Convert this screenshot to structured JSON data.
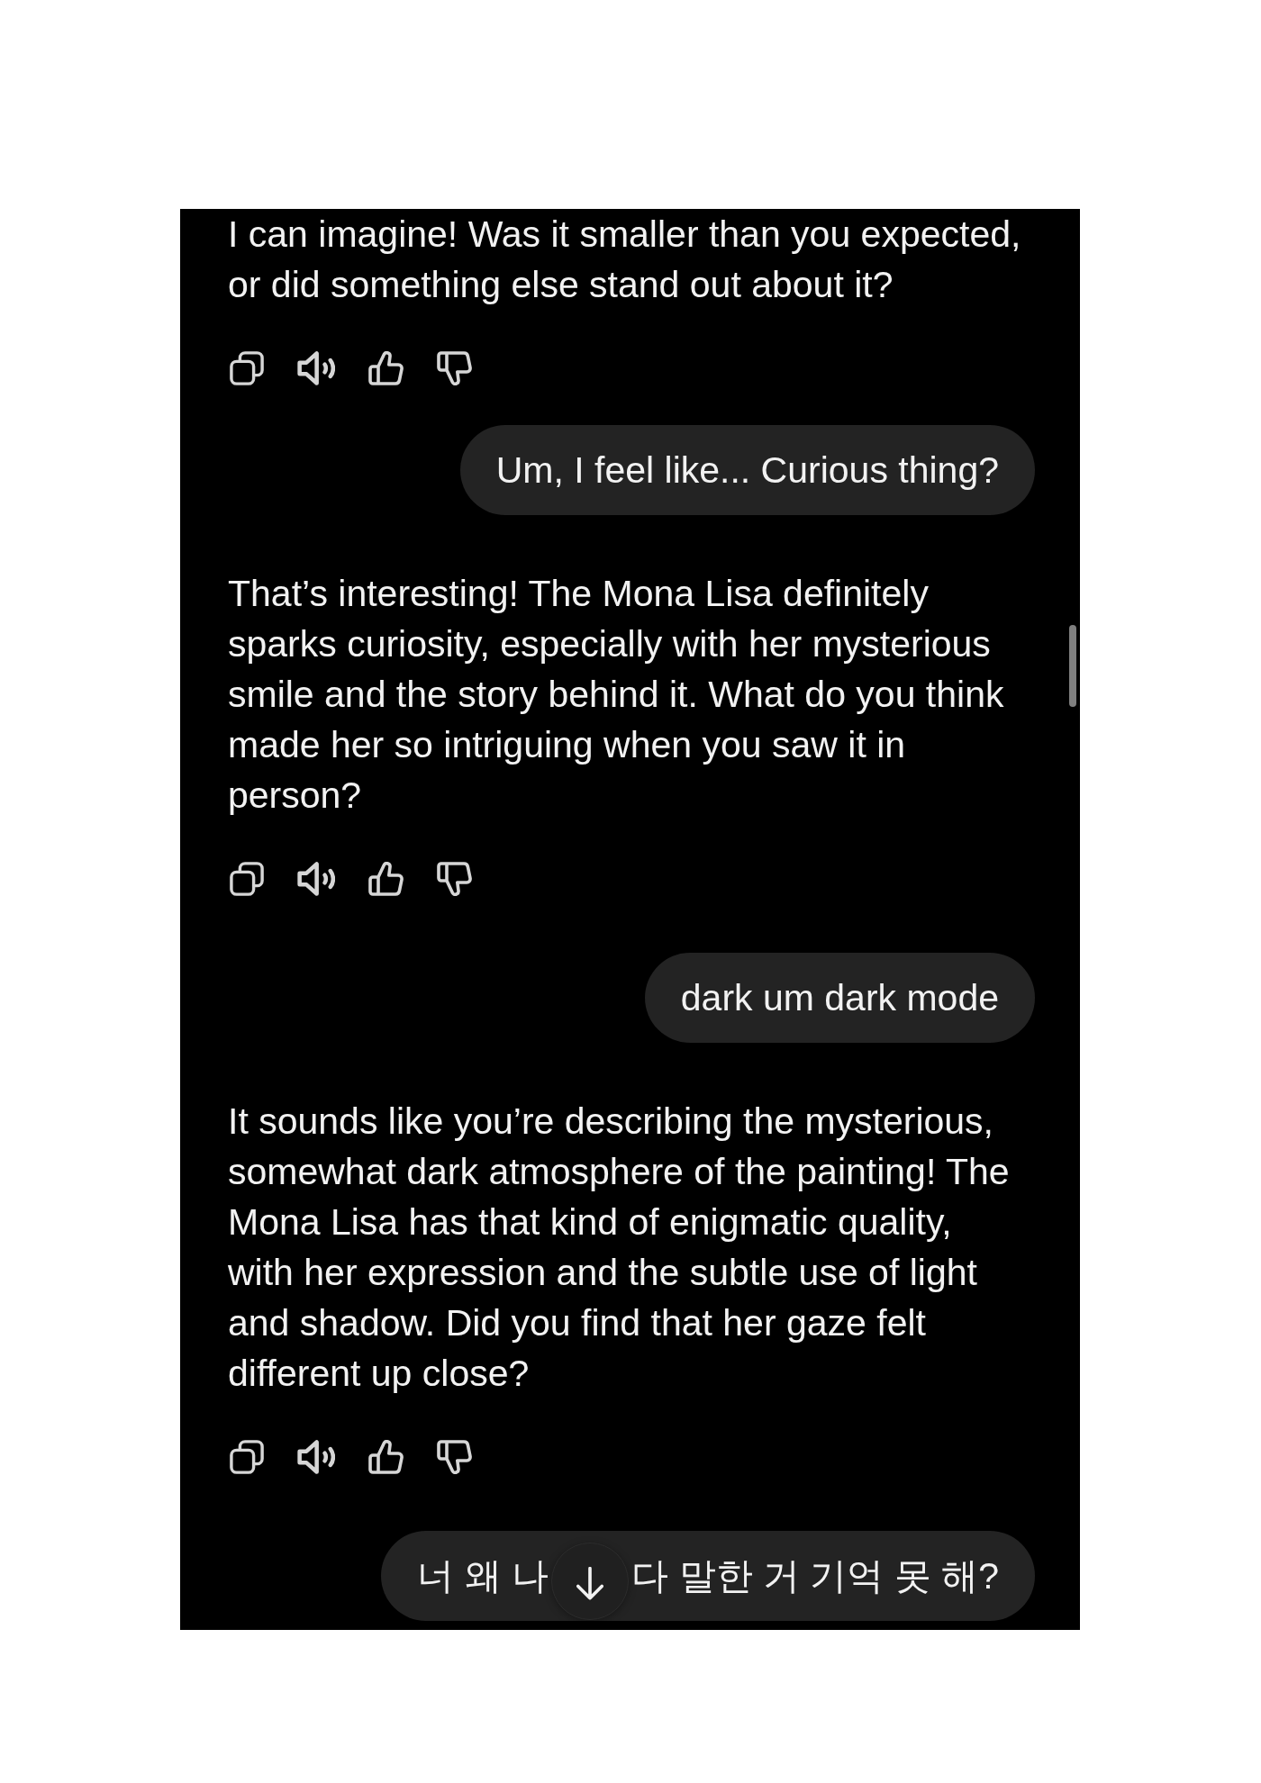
{
  "messages": [
    {
      "kind": "assistant",
      "text": "I can imagine! Was it smaller than you expected, or did something else stand out about it?"
    },
    {
      "kind": "user",
      "text_parts": [
        "Um, I feel like... Curious thing?"
      ]
    },
    {
      "kind": "assistant",
      "text": "That’s interesting! The Mona Lisa definitely sparks curiosity, especially with her mysterious smile and the story behind it. What do you think made her so intriguing when you saw it in person?"
    },
    {
      "kind": "user",
      "text_parts": [
        "dark um dark mode"
      ]
    },
    {
      "kind": "assistant",
      "text": "It sounds like you’re describing the mysterious, somewhat dark atmosphere of the painting! The Mona Lisa has that kind of enigmatic quality, with her expression and the subtle use of light and shadow. Did you find that her gaze felt different up close?"
    },
    {
      "kind": "user",
      "text_parts": [
        "너 왜 나",
        "다 말한 거 기억 못 해?"
      ]
    }
  ]
}
